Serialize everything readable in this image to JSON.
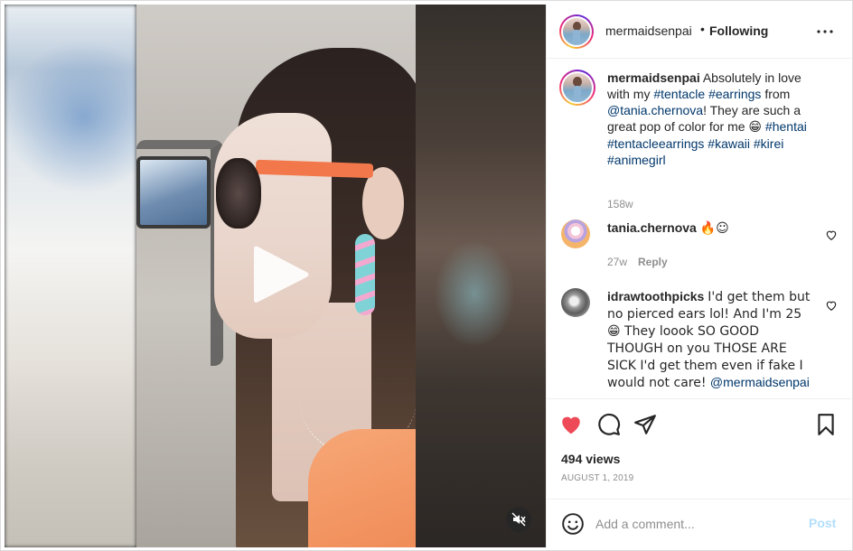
{
  "header": {
    "username": "mermaidsenpai",
    "separator": "•",
    "follow_status": "Following",
    "more_icon": "more-horizontal-icon"
  },
  "caption": {
    "username": "mermaidsenpai",
    "parts": {
      "t1": "Absolutely in love with my ",
      "h1": "#tentacle",
      "t2": " ",
      "h2": "#earrings",
      "t3": " from ",
      "m1": "@tania.chernova",
      "t4": "! They are such a great pop of color for me ",
      "e1": "😁",
      "t5": " ",
      "h3": "#hentai",
      "t6": " ",
      "h4": "#tentacleearrings",
      "t7": " ",
      "h5": "#kawaii",
      "t8": " ",
      "h6": "#kirei",
      "t9": " ",
      "h7": "#animegirl"
    },
    "age": "158w"
  },
  "comments": [
    {
      "username": "tania.chernova",
      "text": "🔥☺",
      "age": "27w",
      "reply_label": "Reply"
    },
    {
      "username": "idrawtoothpicks",
      "text": "I'd get them but no pierced ears lol! And I'm 25 😁 They loook SO GOOD THOUGH on you THOSE ARE SICK I'd get them even if fake I would not care! ",
      "mention": "@mermaidsenpai"
    }
  ],
  "stats": {
    "views": "494 views",
    "date": "AUGUST 1, 2019"
  },
  "comment_box": {
    "placeholder": "Add a comment...",
    "post_label": "Post"
  },
  "colors": {
    "like_red": "#ed4956",
    "link_blue": "#00376b",
    "post_disabled": "#b2dffc"
  },
  "video": {
    "play_icon": "play-icon",
    "mute_icon": "muted-speaker-icon"
  }
}
